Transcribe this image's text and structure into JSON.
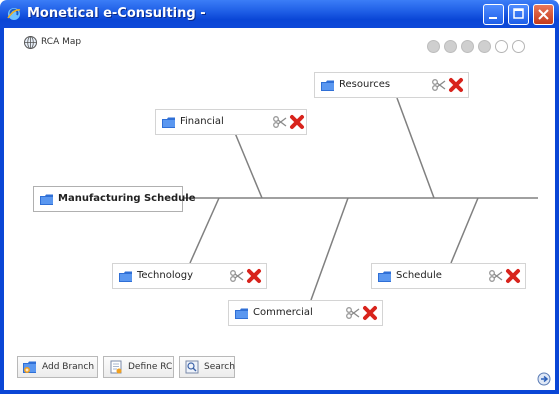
{
  "window": {
    "title": "Monetical e-Consulting -"
  },
  "map": {
    "label": "RCA Map"
  },
  "zoom_dots": {
    "filled": 4,
    "total": 6
  },
  "diagram": {
    "root": "Manufacturing Schedule",
    "branches": [
      {
        "label": "Financial"
      },
      {
        "label": "Resources"
      },
      {
        "label": "Technology"
      },
      {
        "label": "Commercial"
      },
      {
        "label": "Schedule"
      }
    ]
  },
  "toolbar": {
    "add_branch": "Add Branch",
    "define_rc": "Define RC",
    "search": "Search"
  },
  "colors": {
    "titlebar": "#0a46d6",
    "delete": "#d8231c",
    "spine": "#808080"
  }
}
